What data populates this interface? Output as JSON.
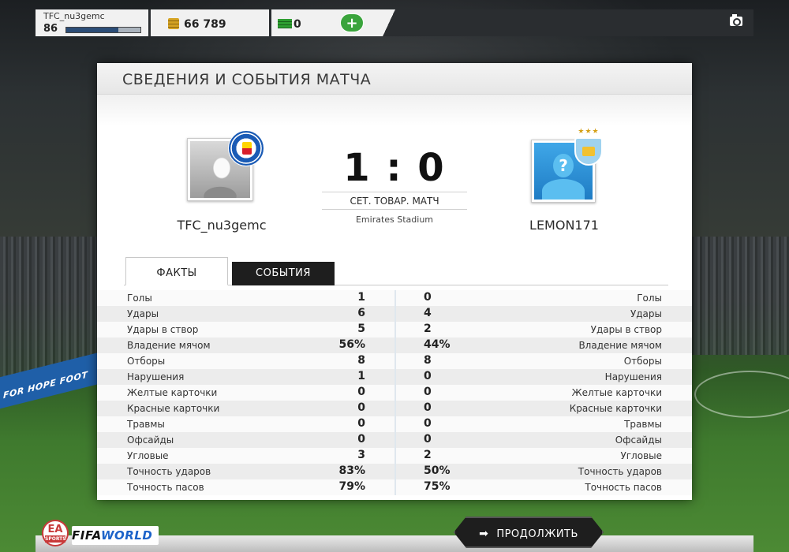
{
  "topbar": {
    "username": "TFC_nu3gemc",
    "level": "86",
    "xp_fraction": 0.7,
    "coins": "66 789",
    "cash": "0",
    "add_label": "+"
  },
  "panel": {
    "title": "СВЕДЕНИЯ И СОБЫТИЯ МАТЧА",
    "home_team": "TFC_nu3gemc",
    "away_team": "LEMON171",
    "score": "1 : 0",
    "match_type": "СЕТ. ТОВАР. МАТЧ",
    "stadium": "Emirates Stadium",
    "away_stars": "★★★"
  },
  "tabs": {
    "facts": "ФАКТЫ",
    "events": "СОБЫТИЯ"
  },
  "stats": [
    {
      "label": "Голы",
      "home": "1",
      "away": "0"
    },
    {
      "label": "Удары",
      "home": "6",
      "away": "4"
    },
    {
      "label": "Удары в створ",
      "home": "5",
      "away": "2"
    },
    {
      "label": "Владение мячом",
      "home": "56%",
      "away": "44%"
    },
    {
      "label": "Отборы",
      "home": "8",
      "away": "8"
    },
    {
      "label": "Нарушения",
      "home": "1",
      "away": "0"
    },
    {
      "label": "Желтые карточки",
      "home": "0",
      "away": "0"
    },
    {
      "label": "Красные карточки",
      "home": "0",
      "away": "0"
    },
    {
      "label": "Травмы",
      "home": "0",
      "away": "0"
    },
    {
      "label": "Офсайды",
      "home": "0",
      "away": "0"
    },
    {
      "label": "Угловые",
      "home": "3",
      "away": "2"
    },
    {
      "label": "Точность ударов",
      "home": "83%",
      "away": "50%"
    },
    {
      "label": "Точность пасов",
      "home": "79%",
      "away": "75%"
    }
  ],
  "bottombar": {
    "continue_label": "ПРОДОЛЖИТЬ",
    "continue_icon": "arrow-right-icon",
    "ea_text": "EA",
    "ea_sports": "SPORTS",
    "fifa_text": "FIFA",
    "world_text": "WORLD"
  },
  "background": {
    "adboard_text": "FOR HOPE  FOOT"
  },
  "colors": {
    "accent_green": "#3aa43c",
    "button_dark": "#1e1e1e",
    "xp_fill": "#2b4d77"
  }
}
